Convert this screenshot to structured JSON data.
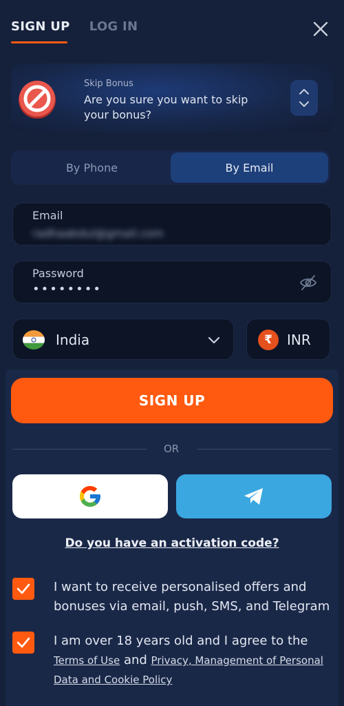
{
  "tabs": {
    "signup": "SIGN UP",
    "login": "LOG IN"
  },
  "bonus": {
    "small_label": "Skip Bonus",
    "message": "Are you sure you want to skip your bonus?"
  },
  "method": {
    "phone": "By Phone",
    "email": "By Email"
  },
  "email_field": {
    "label": "Email",
    "value": "radhaabdul@gmail.com"
  },
  "password_field": {
    "label": "Password",
    "value": "••••••••"
  },
  "country": {
    "name": "India"
  },
  "currency": {
    "code": "INR",
    "symbol": "₹"
  },
  "signup_button": "SIGN UP",
  "or_text": "OR",
  "activation_link": "Do you have an activation code?",
  "consent": {
    "offers": "I want to receive personalised offers and bonuses via email, push, SMS, and Telegram",
    "age_text": "I am over 18 years old and I agree to the",
    "terms_link": "Terms of Use",
    "and_text": "and",
    "privacy_link": "Privacy, Management of Personal Data and Cookie Policy"
  },
  "colors": {
    "background": "#15203a",
    "accent": "#ff5a10",
    "telegram": "#3aa7e0",
    "active_segment": "#1d3f7a"
  }
}
